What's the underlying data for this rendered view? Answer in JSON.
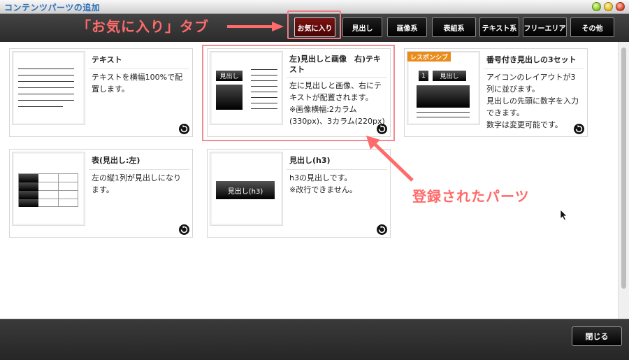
{
  "window": {
    "title": "コンテンツパーツの追加"
  },
  "annotations": {
    "favorites_tab_note": "「お気に入り」タブ",
    "registered_parts_note": "登録されたパーツ"
  },
  "tabs": [
    {
      "label": "お気に入り",
      "active": true
    },
    {
      "label": "見出し"
    },
    {
      "label": "画像系"
    },
    {
      "label": "表組系"
    },
    {
      "label": "テキスト系"
    },
    {
      "label": "フリーエリア"
    },
    {
      "label": "その他"
    }
  ],
  "cards": [
    {
      "title": "テキスト",
      "description": "テキストを横幅100%で配置します。"
    },
    {
      "title": "左)見出しと画像　右)テキスト",
      "description": "左に見出しと画像、右にテキストが配置されます。\n※画像横幅:2カラム(330px)、3カラム(220px)",
      "thumb_label": "見出し"
    },
    {
      "title": "番号付き見出しの3セット",
      "description": "アイコンのレイアウトが3列に並びます。\n見出しの先頭に数字を入力できます。\n数字は変更可能です。",
      "badge": "レスポンシブ",
      "thumb_number": "1",
      "thumb_label": "見出し"
    },
    {
      "title": "表(見出し:左)",
      "description": "左の縦1列が見出しになります。"
    },
    {
      "title": "見出し(h3)",
      "description": "h3の見出しです。\n※改行できません。",
      "thumb_label": "見出し(h3)"
    }
  ],
  "footer": {
    "close_label": "閉じる"
  },
  "colors": {
    "accent": "#ff6a6a",
    "active_tab": "#6a0f0f"
  }
}
